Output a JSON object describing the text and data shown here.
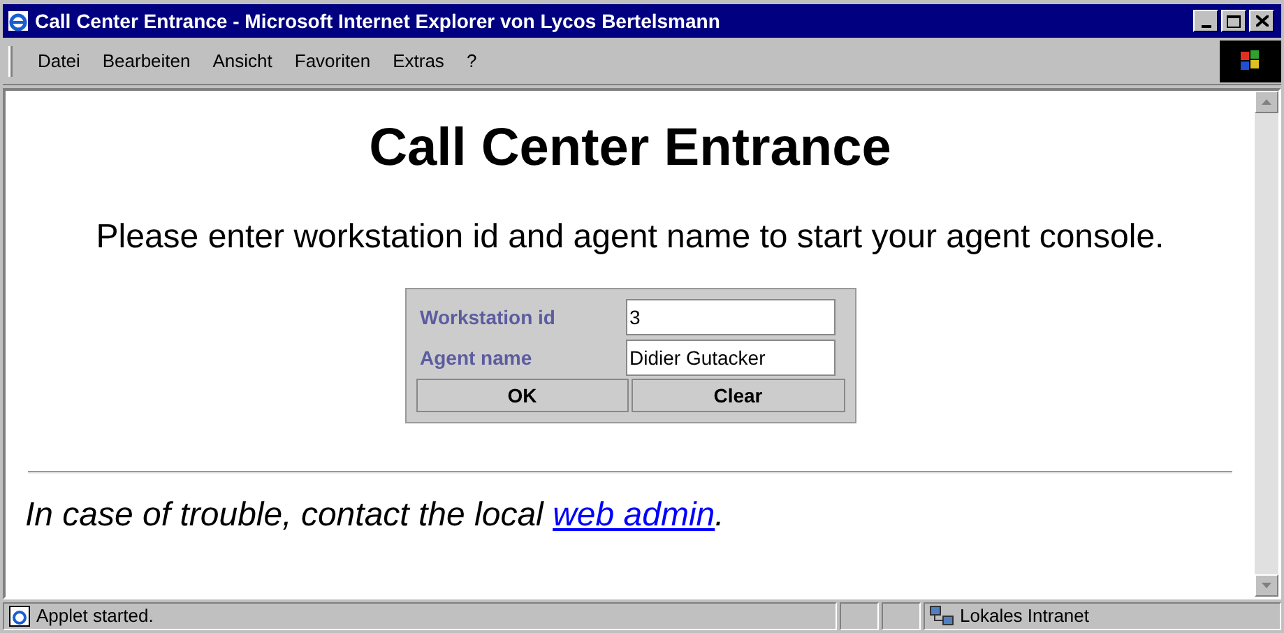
{
  "window": {
    "title": "Call Center Entrance - Microsoft Internet Explorer von Lycos Bertelsmann"
  },
  "menu": [
    "Datei",
    "Bearbeiten",
    "Ansicht",
    "Favoriten",
    "Extras",
    "?"
  ],
  "page": {
    "heading": "Call Center Entrance",
    "intro": "Please enter workstation id and agent name to start your agent console.",
    "form": {
      "fields": [
        {
          "label": "Workstation id",
          "value": "3"
        },
        {
          "label": "Agent name",
          "value": "Didier Gutacker"
        }
      ],
      "buttons": [
        "OK",
        "Clear"
      ]
    },
    "footer_text": "In case of trouble, contact the local ",
    "footer_link": "web admin",
    "footer_end": "."
  },
  "status_bar": {
    "message": "Applet started.",
    "zone": "Lokales Intranet"
  }
}
